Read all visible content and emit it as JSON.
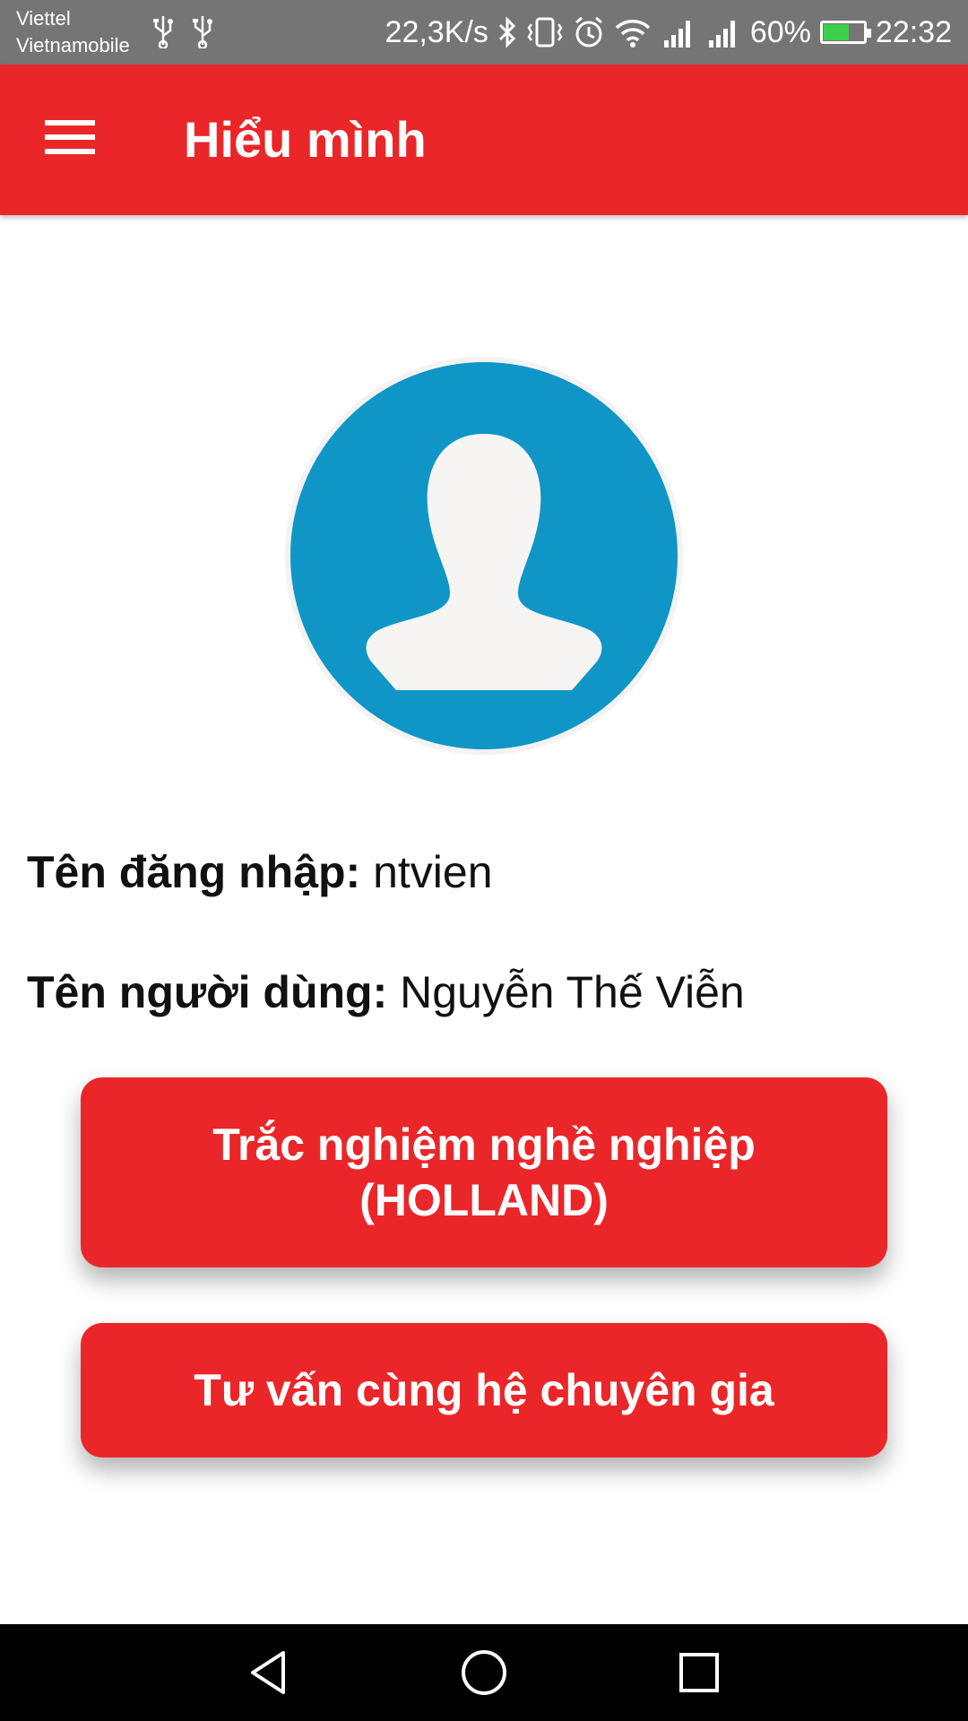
{
  "status_bar": {
    "carrier_1": "Viettel",
    "carrier_2": "Vietnamobile",
    "net_speed": "22,3K/s",
    "battery": "60%",
    "time": "22:32",
    "battery_level": 0.6,
    "icons": [
      "usb-icon",
      "usb-icon",
      "bluetooth-icon",
      "vibrate-icon",
      "alarm-icon",
      "wifi-icon",
      "signal-icon",
      "signal-icon",
      "battery-icon"
    ]
  },
  "app_bar": {
    "title": "Hiểu mình",
    "menu_icon": "hamburger-menu-icon"
  },
  "profile": {
    "avatar_icon": "user-silhouette-icon",
    "username_label": "Tên đăng nhập:",
    "username_value": "ntvien",
    "fullname_label": "Tên người dùng:",
    "fullname_value": "Nguyễn Thế Viễn"
  },
  "actions": {
    "holland_line1": "Trắc nghiệm nghề nghiệp",
    "holland_line2": "(HOLLAND)",
    "expert_label": "Tư vấn cùng hệ chuyên gia"
  },
  "nav_bar": {
    "icons": [
      "back-icon",
      "home-icon",
      "recents-icon"
    ]
  },
  "colors": {
    "primary": "#ea2629",
    "avatar_bg": "#0f96c6",
    "status_bar": "#757575"
  }
}
